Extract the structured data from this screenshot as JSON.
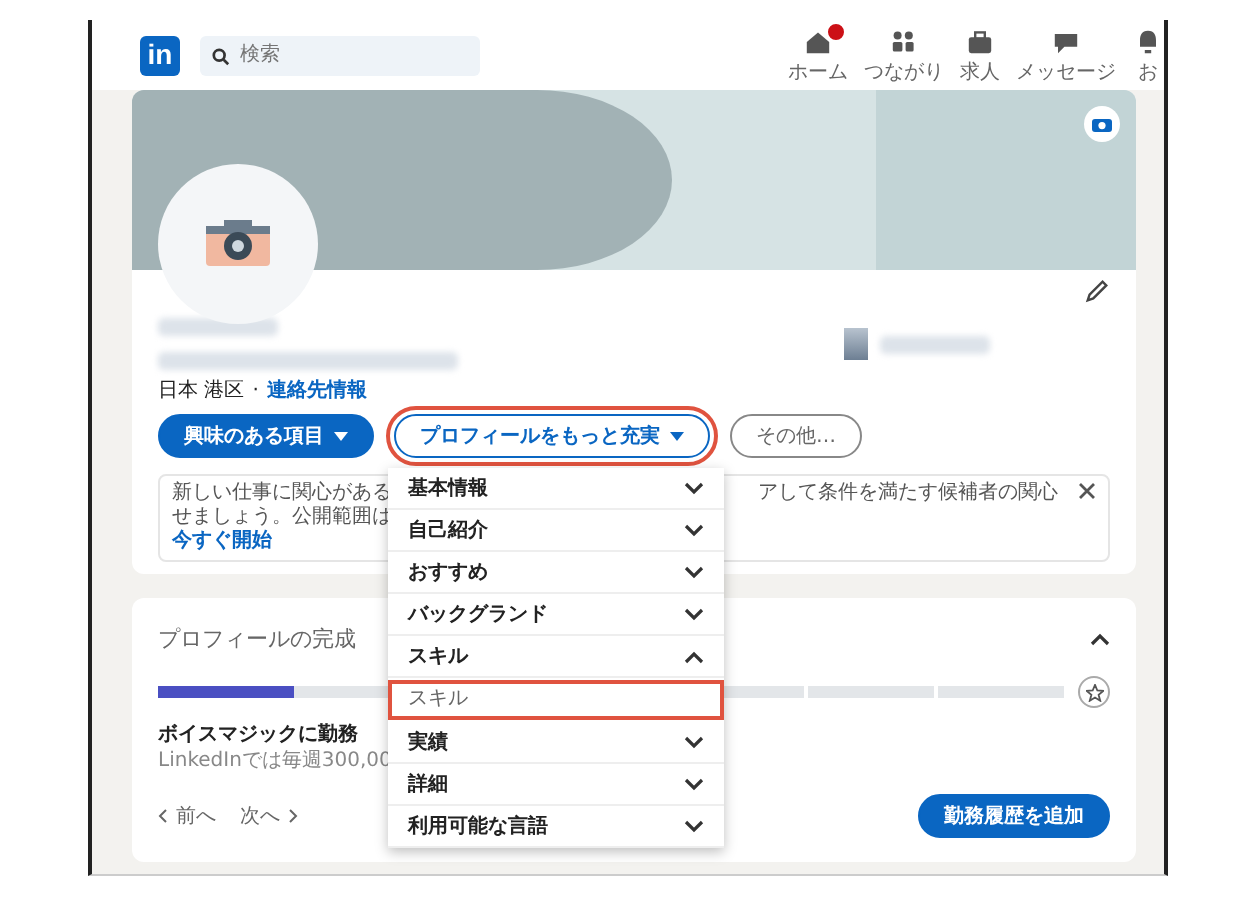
{
  "nav": {
    "logo": "in",
    "search": {
      "placeholder": "検索"
    },
    "items": [
      {
        "kind": "home",
        "label": "ホーム",
        "badge": true
      },
      {
        "kind": "network",
        "label": "つながり",
        "badge": false
      },
      {
        "kind": "jobs",
        "label": "求人",
        "badge": false
      },
      {
        "kind": "messaging",
        "label": "メッセージ",
        "badge": false
      },
      {
        "kind": "notifications",
        "label": "お",
        "badge": false
      }
    ]
  },
  "profile": {
    "location": "日本 港区",
    "separator": "·",
    "contact_link": "連絡先情報",
    "actions": [
      {
        "label": "興味のある項目",
        "kind": "primary",
        "caret": true,
        "highlighted": false
      },
      {
        "label": "プロフィールをもっと充実",
        "kind": "secondary",
        "caret": true,
        "highlighted": true
      },
      {
        "label": "その他…",
        "kind": "outline",
        "caret": false,
        "highlighted": false
      }
    ],
    "notice": {
      "lines": [
        "新しい仕事に関心がある",
        "せましょう。公開範囲は"
      ],
      "link": "今すぐ開始",
      "right_text": "アして条件を満たす候補者の関心"
    }
  },
  "dropdown": {
    "sections": [
      {
        "label": "基本情報",
        "expanded": false
      },
      {
        "label": "自己紹介",
        "expanded": false
      },
      {
        "label": "おすすめ",
        "expanded": false
      },
      {
        "label": "バックグランド",
        "expanded": false
      },
      {
        "label": "スキル",
        "expanded": true,
        "children": [
          {
            "label": "スキル",
            "highlighted": true
          }
        ]
      },
      {
        "label": "実績",
        "expanded": false
      },
      {
        "label": "詳細",
        "expanded": false
      },
      {
        "label": "利用可能な言語",
        "expanded": false
      }
    ]
  },
  "completion": {
    "title": "プロフィールの完成",
    "expanded": true,
    "progress": {
      "level": 0.15
    },
    "suggestion": {
      "title": "ボイスマジックに勤務",
      "text": "LinkedInでは毎週300,00"
    },
    "prev": "前へ",
    "next": "次へ",
    "action": "勤務履歴を追加"
  }
}
